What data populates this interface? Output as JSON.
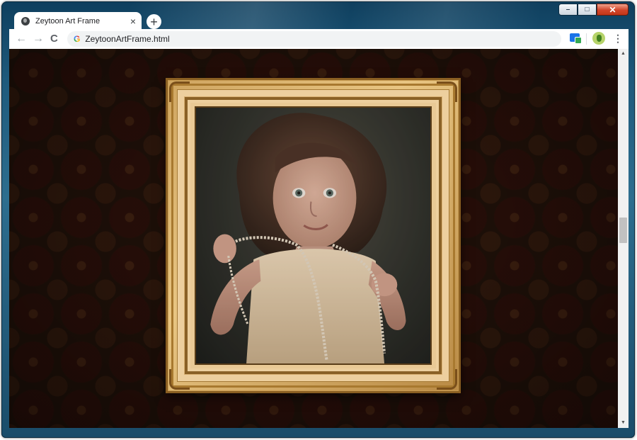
{
  "window": {
    "controls": {
      "minimize": "–",
      "maximize": "□",
      "close": "✕"
    }
  },
  "tab": {
    "title": "Zeytoon Art Frame",
    "close_label": "×",
    "icon": "globe-icon"
  },
  "new_tab": {
    "label": "+"
  },
  "toolbar": {
    "back_label": "←",
    "forward_label": "→",
    "reload_label": "C",
    "url": "ZeytoonArtFrame.html",
    "search_engine_icon": "google-g-icon",
    "menu_label": "⋮"
  },
  "scrollbar": {
    "up": "▲",
    "down": "▼",
    "position": 0.5
  },
  "artwork": {
    "subject": "vintage-portrait-photo",
    "frame_style": "gilded-ornate"
  },
  "colors": {
    "frame_gold": "#cfa560",
    "wallpaper": "#1c0f08"
  }
}
